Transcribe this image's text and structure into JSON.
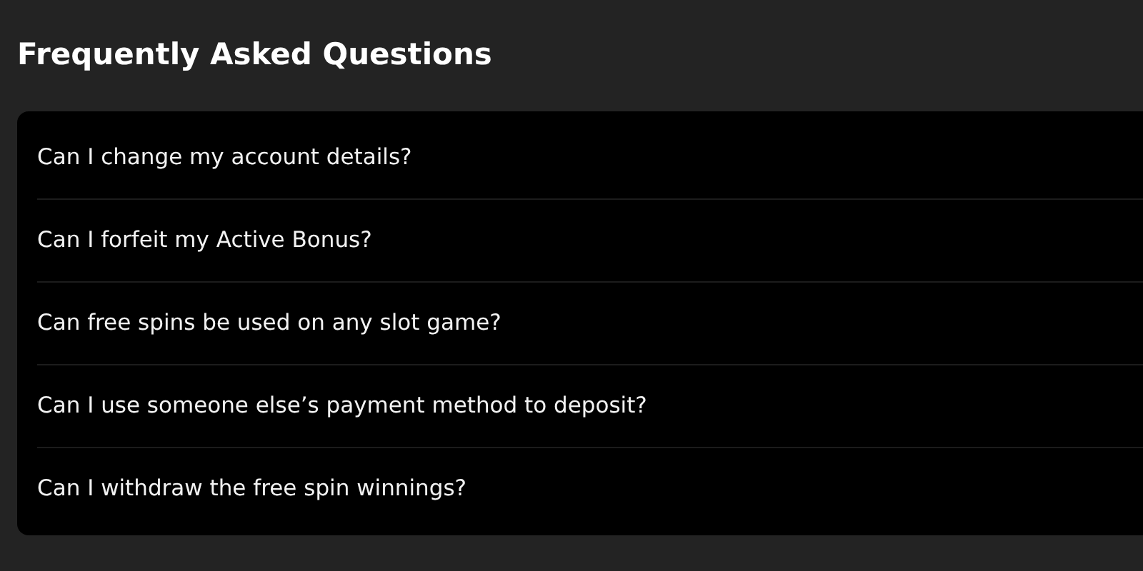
{
  "heading": "Frequently Asked Questions",
  "questions": [
    {
      "text": "Can I change my account details?"
    },
    {
      "text": "Can I forfeit my Active Bonus?"
    },
    {
      "text": "Can free spins be used on any slot game?"
    },
    {
      "text": "Can I use someone else’s payment method to deposit?"
    },
    {
      "text": "Can I withdraw the free spin winnings?"
    }
  ]
}
